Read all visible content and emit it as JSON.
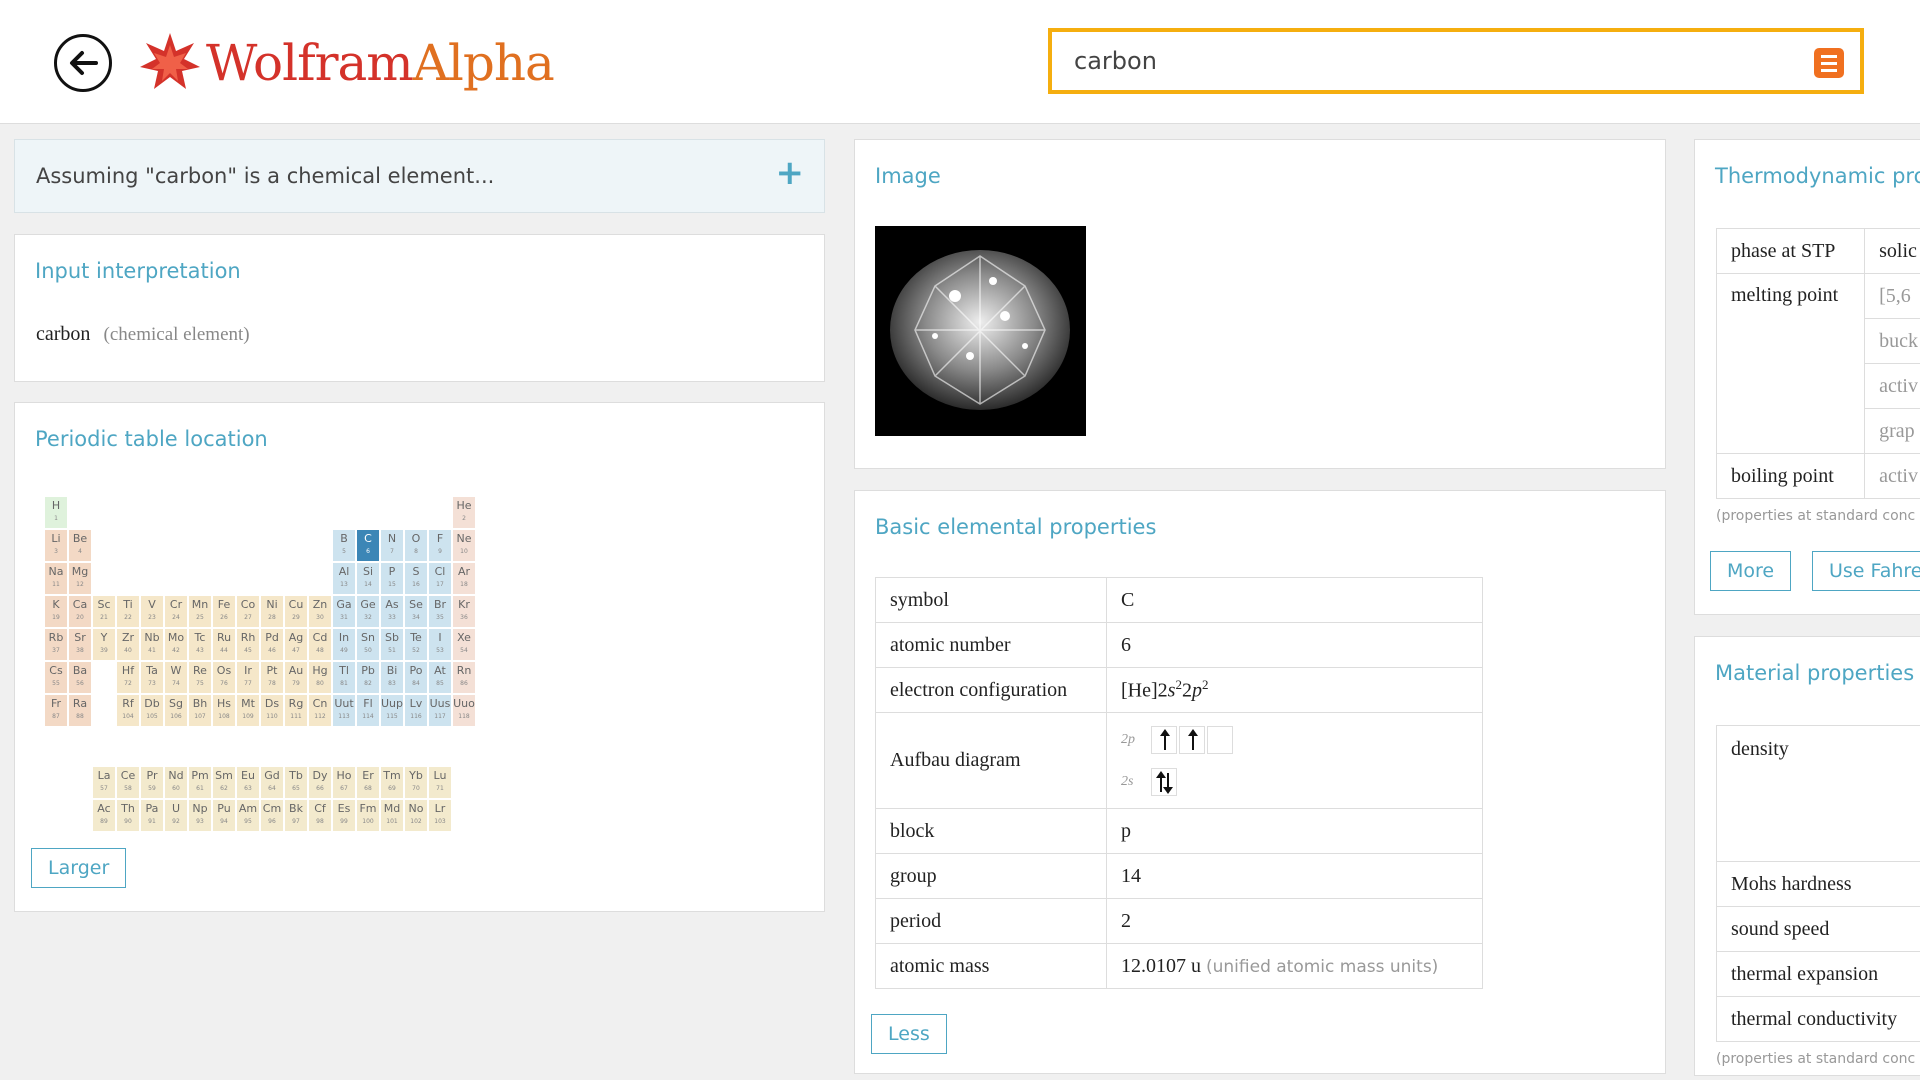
{
  "header": {
    "logo": {
      "brand": "Wolfram",
      "brand2": "Alpha"
    },
    "search": {
      "value": "carbon"
    }
  },
  "assumption": {
    "text": "Assuming \"carbon\" is a chemical element..."
  },
  "input_interpretation": {
    "title": "Input interpretation",
    "main": "carbon",
    "sub": "(chemical element)"
  },
  "periodic_table": {
    "title": "Periodic table location",
    "larger_label": "Larger",
    "highlight": "C",
    "colors": {
      "s": "#f3d9c5",
      "d": "#f5e7c9",
      "p": "#cde3ef",
      "f": "#f3eacd",
      "h": "#dff2dc",
      "noble": "#f4e0d6",
      "highlight": "#3c86b6"
    },
    "elements": [
      [
        "H",
        1,
        1,
        1,
        "h"
      ],
      [
        "He",
        2,
        1,
        18,
        "noble"
      ],
      [
        "Li",
        3,
        2,
        1,
        "s"
      ],
      [
        "Be",
        4,
        2,
        2,
        "s"
      ],
      [
        "B",
        5,
        2,
        13,
        "p"
      ],
      [
        "C",
        6,
        2,
        14,
        "p"
      ],
      [
        "N",
        7,
        2,
        15,
        "p"
      ],
      [
        "O",
        8,
        2,
        16,
        "p"
      ],
      [
        "F",
        9,
        2,
        17,
        "p"
      ],
      [
        "Ne",
        10,
        2,
        18,
        "noble"
      ],
      [
        "Na",
        11,
        3,
        1,
        "s"
      ],
      [
        "Mg",
        12,
        3,
        2,
        "s"
      ],
      [
        "Al",
        13,
        3,
        13,
        "p"
      ],
      [
        "Si",
        14,
        3,
        14,
        "p"
      ],
      [
        "P",
        15,
        3,
        15,
        "p"
      ],
      [
        "S",
        16,
        3,
        16,
        "p"
      ],
      [
        "Cl",
        17,
        3,
        17,
        "p"
      ],
      [
        "Ar",
        18,
        3,
        18,
        "noble"
      ],
      [
        "K",
        19,
        4,
        1,
        "s"
      ],
      [
        "Ca",
        20,
        4,
        2,
        "s"
      ],
      [
        "Sc",
        21,
        4,
        3,
        "d"
      ],
      [
        "Ti",
        22,
        4,
        4,
        "d"
      ],
      [
        "V",
        23,
        4,
        5,
        "d"
      ],
      [
        "Cr",
        24,
        4,
        6,
        "d"
      ],
      [
        "Mn",
        25,
        4,
        7,
        "d"
      ],
      [
        "Fe",
        26,
        4,
        8,
        "d"
      ],
      [
        "Co",
        27,
        4,
        9,
        "d"
      ],
      [
        "Ni",
        28,
        4,
        10,
        "d"
      ],
      [
        "Cu",
        29,
        4,
        11,
        "d"
      ],
      [
        "Zn",
        30,
        4,
        12,
        "d"
      ],
      [
        "Ga",
        31,
        4,
        13,
        "p"
      ],
      [
        "Ge",
        32,
        4,
        14,
        "p"
      ],
      [
        "As",
        33,
        4,
        15,
        "p"
      ],
      [
        "Se",
        34,
        4,
        16,
        "p"
      ],
      [
        "Br",
        35,
        4,
        17,
        "p"
      ],
      [
        "Kr",
        36,
        4,
        18,
        "noble"
      ],
      [
        "Rb",
        37,
        5,
        1,
        "s"
      ],
      [
        "Sr",
        38,
        5,
        2,
        "s"
      ],
      [
        "Y",
        39,
        5,
        3,
        "d"
      ],
      [
        "Zr",
        40,
        5,
        4,
        "d"
      ],
      [
        "Nb",
        41,
        5,
        5,
        "d"
      ],
      [
        "Mo",
        42,
        5,
        6,
        "d"
      ],
      [
        "Tc",
        43,
        5,
        7,
        "d"
      ],
      [
        "Ru",
        44,
        5,
        8,
        "d"
      ],
      [
        "Rh",
        45,
        5,
        9,
        "d"
      ],
      [
        "Pd",
        46,
        5,
        10,
        "d"
      ],
      [
        "Ag",
        47,
        5,
        11,
        "d"
      ],
      [
        "Cd",
        48,
        5,
        12,
        "d"
      ],
      [
        "In",
        49,
        5,
        13,
        "p"
      ],
      [
        "Sn",
        50,
        5,
        14,
        "p"
      ],
      [
        "Sb",
        51,
        5,
        15,
        "p"
      ],
      [
        "Te",
        52,
        5,
        16,
        "p"
      ],
      [
        "I",
        53,
        5,
        17,
        "p"
      ],
      [
        "Xe",
        54,
        5,
        18,
        "noble"
      ],
      [
        "Cs",
        55,
        6,
        1,
        "s"
      ],
      [
        "Ba",
        56,
        6,
        2,
        "s"
      ],
      [
        "Hf",
        72,
        6,
        4,
        "d"
      ],
      [
        "Ta",
        73,
        6,
        5,
        "d"
      ],
      [
        "W",
        74,
        6,
        6,
        "d"
      ],
      [
        "Re",
        75,
        6,
        7,
        "d"
      ],
      [
        "Os",
        76,
        6,
        8,
        "d"
      ],
      [
        "Ir",
        77,
        6,
        9,
        "d"
      ],
      [
        "Pt",
        78,
        6,
        10,
        "d"
      ],
      [
        "Au",
        79,
        6,
        11,
        "d"
      ],
      [
        "Hg",
        80,
        6,
        12,
        "d"
      ],
      [
        "Tl",
        81,
        6,
        13,
        "p"
      ],
      [
        "Pb",
        82,
        6,
        14,
        "p"
      ],
      [
        "Bi",
        83,
        6,
        15,
        "p"
      ],
      [
        "Po",
        84,
        6,
        16,
        "p"
      ],
      [
        "At",
        85,
        6,
        17,
        "p"
      ],
      [
        "Rn",
        86,
        6,
        18,
        "noble"
      ],
      [
        "Fr",
        87,
        7,
        1,
        "s"
      ],
      [
        "Ra",
        88,
        7,
        2,
        "s"
      ],
      [
        "Rf",
        104,
        7,
        4,
        "d"
      ],
      [
        "Db",
        105,
        7,
        5,
        "d"
      ],
      [
        "Sg",
        106,
        7,
        6,
        "d"
      ],
      [
        "Bh",
        107,
        7,
        7,
        "d"
      ],
      [
        "Hs",
        108,
        7,
        8,
        "d"
      ],
      [
        "Mt",
        109,
        7,
        9,
        "d"
      ],
      [
        "Ds",
        110,
        7,
        10,
        "d"
      ],
      [
        "Rg",
        111,
        7,
        11,
        "d"
      ],
      [
        "Cn",
        112,
        7,
        12,
        "d"
      ],
      [
        "Uut",
        113,
        7,
        13,
        "p"
      ],
      [
        "Fl",
        114,
        7,
        14,
        "p"
      ],
      [
        "Uup",
        115,
        7,
        15,
        "p"
      ],
      [
        "Lv",
        116,
        7,
        16,
        "p"
      ],
      [
        "Uus",
        117,
        7,
        17,
        "p"
      ],
      [
        "Uuo",
        118,
        7,
        18,
        "noble"
      ],
      [
        "La",
        57,
        9,
        3,
        "f"
      ],
      [
        "Ce",
        58,
        9,
        4,
        "f"
      ],
      [
        "Pr",
        59,
        9,
        5,
        "f"
      ],
      [
        "Nd",
        60,
        9,
        6,
        "f"
      ],
      [
        "Pm",
        61,
        9,
        7,
        "f"
      ],
      [
        "Sm",
        62,
        9,
        8,
        "f"
      ],
      [
        "Eu",
        63,
        9,
        9,
        "f"
      ],
      [
        "Gd",
        64,
        9,
        10,
        "f"
      ],
      [
        "Tb",
        65,
        9,
        11,
        "f"
      ],
      [
        "Dy",
        66,
        9,
        12,
        "f"
      ],
      [
        "Ho",
        67,
        9,
        13,
        "f"
      ],
      [
        "Er",
        68,
        9,
        14,
        "f"
      ],
      [
        "Tm",
        69,
        9,
        15,
        "f"
      ],
      [
        "Yb",
        70,
        9,
        16,
        "f"
      ],
      [
        "Lu",
        71,
        9,
        17,
        "f"
      ],
      [
        "Ac",
        89,
        10,
        3,
        "f"
      ],
      [
        "Th",
        90,
        10,
        4,
        "f"
      ],
      [
        "Pa",
        91,
        10,
        5,
        "f"
      ],
      [
        "U",
        92,
        10,
        6,
        "f"
      ],
      [
        "Np",
        93,
        10,
        7,
        "f"
      ],
      [
        "Pu",
        94,
        10,
        8,
        "f"
      ],
      [
        "Am",
        95,
        10,
        9,
        "f"
      ],
      [
        "Cm",
        96,
        10,
        10,
        "f"
      ],
      [
        "Bk",
        97,
        10,
        11,
        "f"
      ],
      [
        "Cf",
        98,
        10,
        12,
        "f"
      ],
      [
        "Es",
        99,
        10,
        13,
        "f"
      ],
      [
        "Fm",
        100,
        10,
        14,
        "f"
      ],
      [
        "Md",
        101,
        10,
        15,
        "f"
      ],
      [
        "No",
        102,
        10,
        16,
        "f"
      ],
      [
        "Lr",
        103,
        10,
        17,
        "f"
      ]
    ]
  },
  "image_pod": {
    "title": "Image"
  },
  "basic_props": {
    "title": "Basic elemental properties",
    "rows": {
      "symbol": {
        "label": "symbol",
        "value": "C"
      },
      "atomic_number": {
        "label": "atomic number",
        "value": "6"
      },
      "electron_configuration": {
        "label": "electron configuration",
        "value_prefix": "[He]",
        "n1": "2",
        "o1": "s",
        "e1": "2",
        "n2": "2",
        "o2": "p",
        "e2": "2"
      },
      "aufbau": {
        "label": "Aufbau diagram",
        "orbital_2p": "2p",
        "orbital_2s": "2s"
      },
      "block": {
        "label": "block",
        "value": "p"
      },
      "group": {
        "label": "group",
        "value": "14"
      },
      "period": {
        "label": "period",
        "value": "2"
      },
      "atomic_mass": {
        "label": "atomic mass",
        "value": "12.0107 u",
        "unit": "(unified atomic mass units)"
      }
    },
    "less_label": "Less"
  },
  "thermo": {
    "title": "Thermodynamic pro",
    "rows": {
      "phase": {
        "label": "phase at STP",
        "value": "solic"
      },
      "melting": {
        "label": "melting point",
        "values": [
          "[5,6",
          "buck",
          "activ",
          "grap"
        ]
      },
      "boiling": {
        "label": "boiling point",
        "value": "activ"
      }
    },
    "note": "(properties at standard conc",
    "more_label": "More",
    "fahrenheit_label": "Use Fahre"
  },
  "material": {
    "title": "Material properties",
    "rows": [
      "density",
      "Mohs hardness",
      "sound speed",
      "thermal expansion",
      "thermal conductivity"
    ],
    "note": "(properties at standard conc"
  }
}
